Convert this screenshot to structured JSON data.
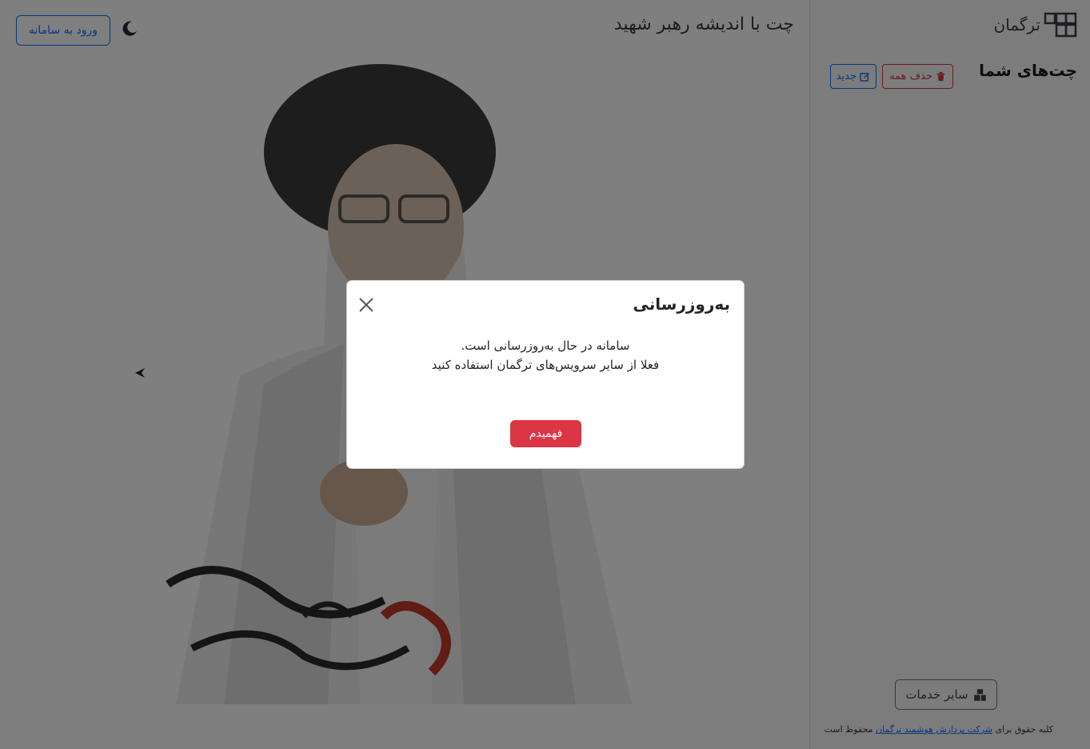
{
  "header": {
    "title": "چت با اندیشه رهبر شهید",
    "login_label": "ورود به سامانه",
    "theme_icon": "moon-icon"
  },
  "sidebar": {
    "brand": "ترگمان",
    "chats_title": "چت‌های شما",
    "delete_all_label": "حذف همه",
    "new_chat_label": "جدید",
    "other_services_label": "سایر خدمات",
    "footer": {
      "prefix": "کلیه حقوق برای",
      "link": "شرکت پردازش هوشمند ترگمان",
      "suffix": "محفوظ است"
    }
  },
  "modal": {
    "title": "به‌روزرسانی",
    "line1": "سامانه در حال به‌روزرسانی است.",
    "line2": "فعلا از سایر سرویس‌های ترگمان استفاده کنید",
    "ok_label": "فهمیدم"
  },
  "colors": {
    "danger": "#dc3545",
    "primary": "#0d6efd",
    "overlay": "rgba(0,0,0,0.5)"
  }
}
